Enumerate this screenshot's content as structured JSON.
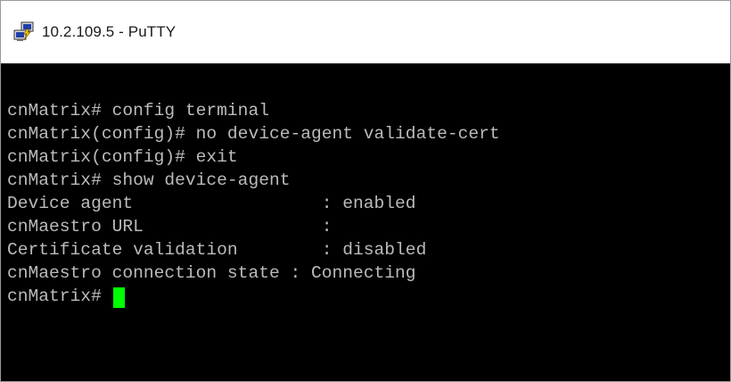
{
  "window": {
    "title": "10.2.109.5 - PuTTY",
    "icon": "putty-icon"
  },
  "terminal": {
    "background": "#000000",
    "text_color": "#bbbbbb",
    "cursor_color": "#00ff00",
    "lines": [
      "cnMatrix# config terminal",
      "cnMatrix(config)# no device-agent validate-cert",
      "cnMatrix(config)# exit",
      "cnMatrix# show device-agent",
      "Device agent                  : enabled",
      "cnMaestro URL                 :",
      "Certificate validation        : disabled",
      "cnMaestro connection state : Connecting"
    ],
    "prompt": "cnMatrix# "
  }
}
